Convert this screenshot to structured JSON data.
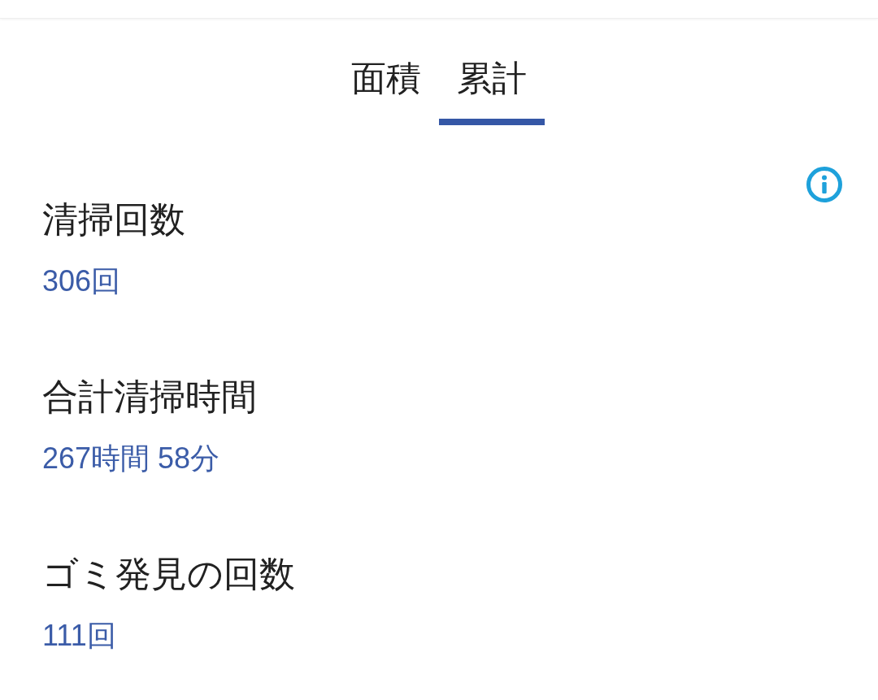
{
  "tabs": [
    {
      "label": "面積",
      "selected": false
    },
    {
      "label": "累計",
      "selected": true
    }
  ],
  "stats": [
    {
      "label": "清掃回数",
      "value": "306回"
    },
    {
      "label": "合計清掃時間",
      "value": "267時間 58分"
    },
    {
      "label": "ゴミ発見の回数",
      "value": "111回"
    }
  ]
}
